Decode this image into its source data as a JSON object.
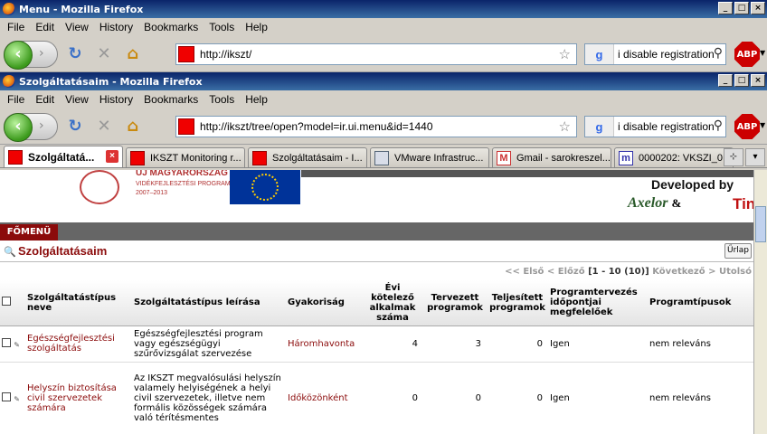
{
  "window1": {
    "title": "Menu - Mozilla Firefox",
    "menu": [
      "File",
      "Edit",
      "View",
      "History",
      "Bookmarks",
      "Tools",
      "Help"
    ],
    "url": "http://ikszt/",
    "search": "i disable registration"
  },
  "window2": {
    "title": "Szolgáltatásaim - Mozilla Firefox",
    "menu": [
      "File",
      "Edit",
      "View",
      "History",
      "Bookmarks",
      "Tools",
      "Help"
    ],
    "url": "http://ikszt/tree/open?model=ir.ui.menu&id=1440",
    "search": "i disable registration",
    "abp": "ABP"
  },
  "tabs": [
    {
      "label": "Szolgáltatá...",
      "active": true
    },
    {
      "label": "IKSZT Monitoring r...",
      "active": false
    },
    {
      "label": "Szolgáltatásaim - I...",
      "active": false
    },
    {
      "label": "VMware Infrastruc...",
      "active": false
    },
    {
      "label": "Gmail - sarokreszel...",
      "active": false
    },
    {
      "label": "0000202: VKSZI_0...",
      "active": false
    }
  ],
  "banner": {
    "logo_line1": "ÚJ MAGYARORSZÁG",
    "logo_line2": "VIDÉKFEJLESZTÉSI PROGRAM",
    "logo_line3": "2007–2013",
    "developed_by": "Developed by",
    "axelor": "Axelor",
    "amp": "&",
    "tiny": "Tin"
  },
  "mainmenu": "FŐMENÜ",
  "page": {
    "title": "Szolgáltatásaim",
    "form_button": "Űrlap",
    "pager": {
      "first": "<< Első",
      "prev": "< Előző",
      "range": "[1 - 10 (10)]",
      "next": "Következő >",
      "last": "Utolsó"
    }
  },
  "table": {
    "headers": [
      "Szolgáltatástípus neve",
      "Szolgáltatástípus leírása",
      "Gyakoriság",
      "Évi kötelező alkalmak száma",
      "Tervezett programok",
      "Teljesített programok",
      "Programtervezés időpontjai megfelelőek",
      "Programtípusok"
    ],
    "rows": [
      {
        "name": "Egészségfejlesztési szolgáltatás",
        "desc": "Egészségfejlesztési program vagy egészségügyi szűrővizsgálat szervezése",
        "freq": "Háromhavonta",
        "required": "4",
        "planned": "3",
        "done": "0",
        "ok": "Igen",
        "types": "nem releváns"
      },
      {
        "name": "Helyszín biztosítása civil szervezetek számára",
        "desc": "Az IKSZT megvalósulási helyszín valamely helyiségének a helyi civil szervezetek, illetve nem formális közösségek számára való térítésmentes",
        "freq": "Időközönként",
        "required": "0",
        "planned": "0",
        "done": "0",
        "ok": "Igen",
        "types": "nem releváns"
      }
    ]
  }
}
